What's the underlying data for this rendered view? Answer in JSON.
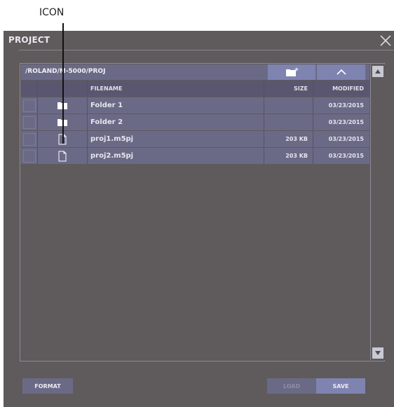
{
  "callout": {
    "label": "ICON"
  },
  "dialog": {
    "title": "PROJECT"
  },
  "browser": {
    "path": "/ROLAND/M-5000/PROJ",
    "columns": {
      "filename": "FILENAME",
      "size": "SIZE",
      "modified": "MODIFIED"
    },
    "rows": [
      {
        "type": "folder",
        "name": "Folder 1",
        "size": "",
        "modified": "03/23/2015"
      },
      {
        "type": "folder",
        "name": "Folder 2",
        "size": "",
        "modified": "03/23/2015"
      },
      {
        "type": "file",
        "name": "proj1.m5pj",
        "size": "203 KB",
        "modified": "03/23/2015"
      },
      {
        "type": "file",
        "name": "proj2.m5pj",
        "size": "203 KB",
        "modified": "03/23/2015"
      }
    ]
  },
  "buttons": {
    "format": "FORMAT",
    "load": "LOAD",
    "save": "SAVE"
  },
  "icons": {
    "close": "close-icon",
    "new_folder": "new-folder-icon",
    "up": "chevron-up-icon",
    "folder": "folder-icon",
    "file": "file-icon",
    "scroll_up": "triangle-up-icon",
    "scroll_down": "triangle-down-icon"
  },
  "colors": {
    "panel": "#5f5a5c",
    "row": "#6b6a86",
    "accent": "#7f83b0",
    "text": "#e6e6ef"
  }
}
